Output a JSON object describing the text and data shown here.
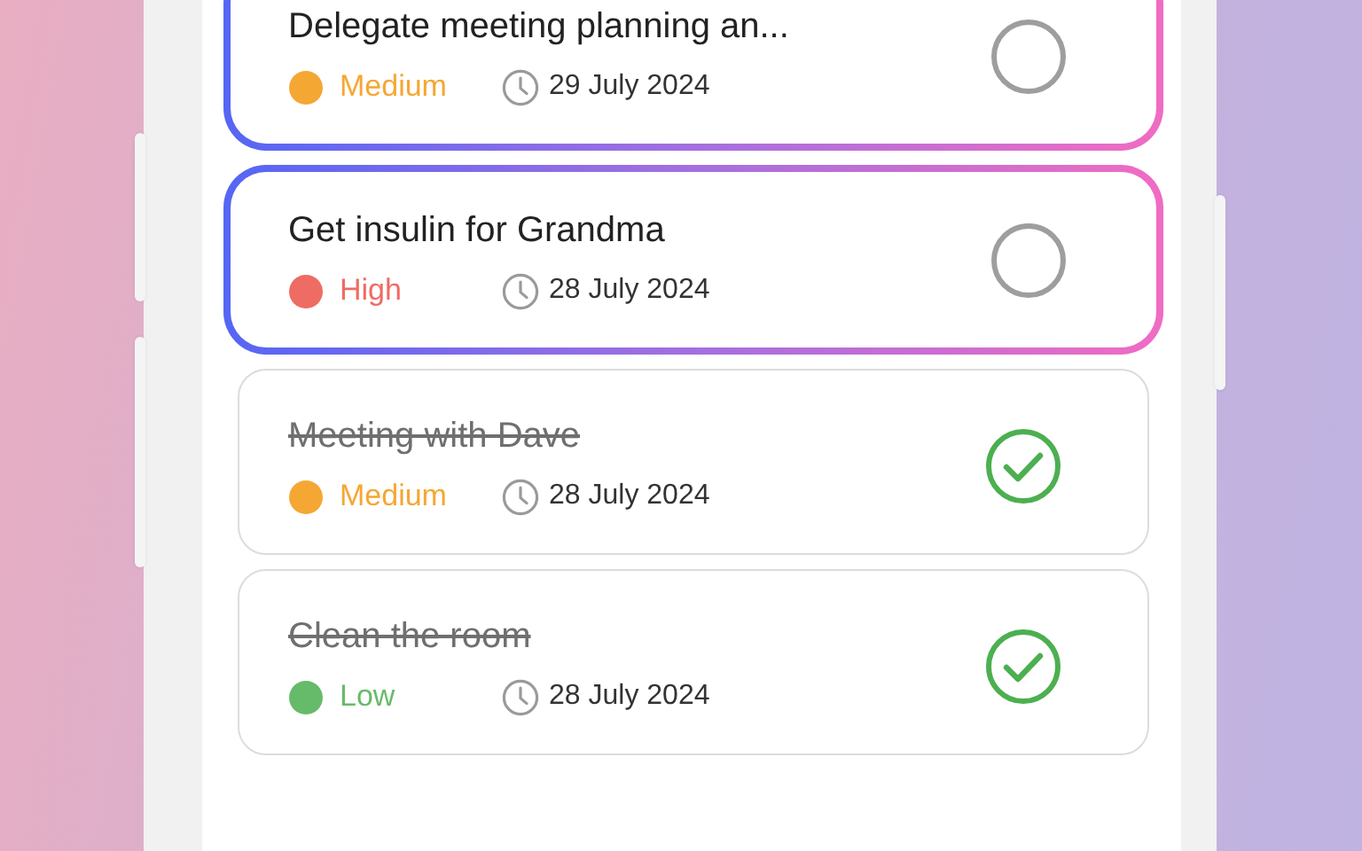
{
  "tasks": [
    {
      "title": "Delegate meeting planning an...",
      "priority": "Medium",
      "color": "#f5a733",
      "date": "29 July 2024",
      "completed": false
    },
    {
      "title": "Get insulin for Grandma",
      "priority": "High",
      "color": "#ee6c63",
      "date": "28 July 2024",
      "completed": false
    },
    {
      "title": "Meeting with Dave",
      "priority": "Medium",
      "color": "#f5a733",
      "date": "28 July 2024",
      "completed": true
    },
    {
      "title": "Clean the room",
      "priority": "Low",
      "color": "#66bb6a",
      "date": "28 July 2024",
      "completed": true
    }
  ]
}
